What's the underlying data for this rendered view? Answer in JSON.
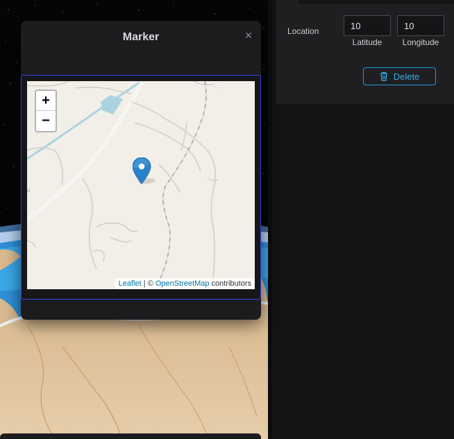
{
  "modal": {
    "title": "Marker",
    "close_glyph": "×",
    "map": {
      "zoom_in": "+",
      "zoom_out": "−",
      "attribution": {
        "leaflet": "Leaflet",
        "separator": " | © ",
        "osm": "OpenStreetMap",
        "suffix": " contributors"
      },
      "marker_icon": "map-pin-icon",
      "marker_color": "#2a81cb",
      "land_color": "#f2efe9",
      "water_color": "#aad3df"
    }
  },
  "side_panel": {
    "location_label": "Location",
    "latitude": {
      "value": "10",
      "caption": "Latitude"
    },
    "longitude": {
      "value": "10",
      "caption": "Longitude"
    },
    "delete_button": {
      "label": "Delete",
      "icon": "trash-icon",
      "color": "#1d9bd6"
    }
  },
  "colors": {
    "panel_bg": "#1f1f22",
    "modal_bg": "#1c1c1f",
    "map_border": "#3a3ee0"
  }
}
